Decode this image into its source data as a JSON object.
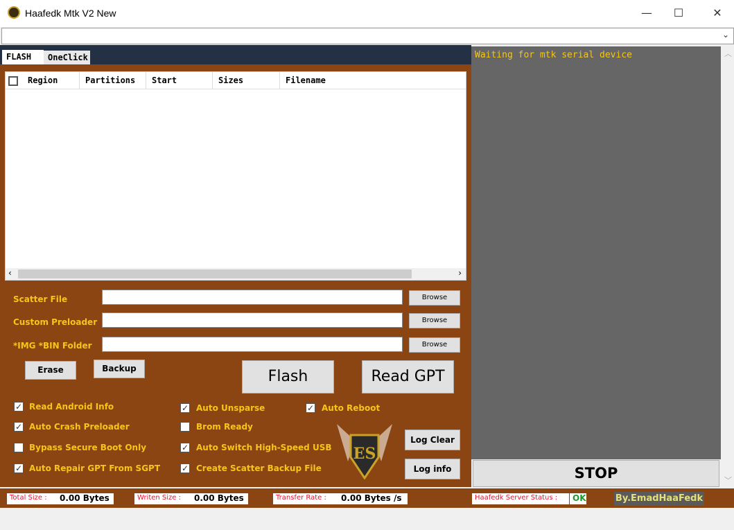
{
  "window": {
    "title": "Haafedk Mtk V2 New",
    "minimize": "—",
    "maximize": "☐",
    "close": "✕"
  },
  "tabs": [
    {
      "label": "FLASH",
      "active": true
    },
    {
      "label": "OneClick",
      "active": false
    }
  ],
  "table": {
    "columns": [
      "Region",
      "Partitions",
      "Start",
      "Sizes",
      "Filename"
    ],
    "rows": []
  },
  "form": {
    "scatter_label": "Scatter File",
    "scatter_value": "",
    "preloader_label": "Custom Preloader",
    "preloader_value": "",
    "folder_label": "*IMG *BIN Folder",
    "folder_value": "",
    "browse": "Browse",
    "erase": "Erase",
    "backup": "Backup",
    "flash": "Flash",
    "read_gpt": "Read GPT",
    "log_clear": "Log Clear",
    "log_info": "Log info"
  },
  "options": [
    {
      "label": "Read Android Info",
      "checked": true
    },
    {
      "label": "Auto Crash Preloader",
      "checked": true
    },
    {
      "label": "Bypass Secure Boot Only",
      "checked": false
    },
    {
      "label": "Auto Repair GPT From SGPT",
      "checked": true
    },
    {
      "label": "Auto Unsparse",
      "checked": true
    },
    {
      "label": "Brom Ready",
      "checked": false
    },
    {
      "label": "Auto Switch High-Speed USB",
      "checked": true
    },
    {
      "label": "Create Scatter Backup File",
      "checked": true
    },
    {
      "label": "Auto Reboot",
      "checked": true
    }
  ],
  "log": {
    "text": "Waiting for mtk serial device"
  },
  "stop": "STOP",
  "status": {
    "total_label": "Total Size :",
    "total_value": "0.00 Bytes",
    "written_label": "Writen Size :",
    "written_value": "0.00 Bytes",
    "rate_label": "Transfer Rate :",
    "rate_value": "0.00 Bytes /s",
    "server_label": "Haafedk Server Status :",
    "server_value": "OK",
    "credit": "By.EmadHaaFedk"
  },
  "colors": {
    "panel": "#8b4513",
    "label": "#f5c518",
    "log_bg": "#666666",
    "ok": "#1a9a2a"
  }
}
